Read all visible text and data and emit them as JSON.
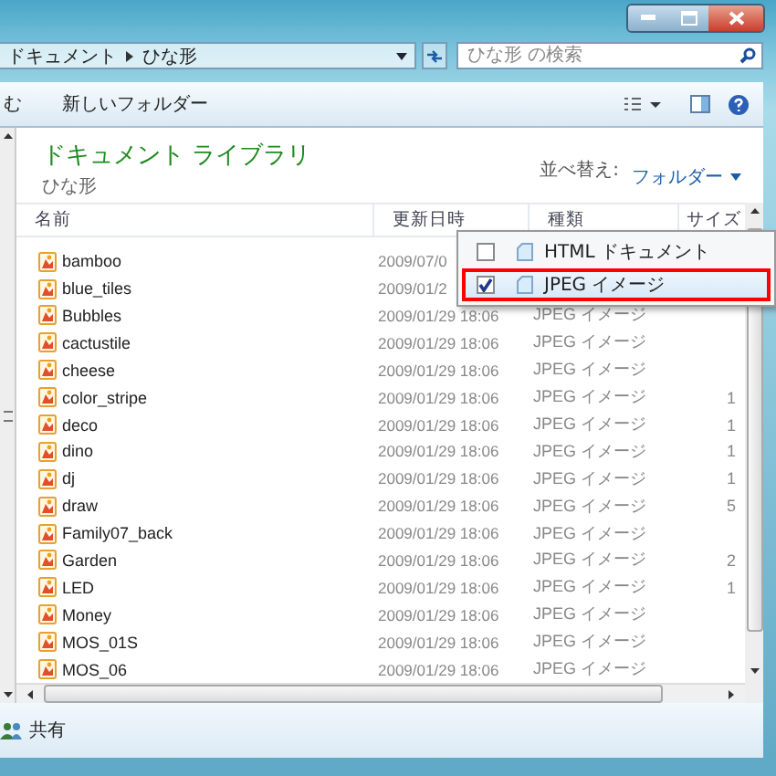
{
  "address": {
    "crumbs": [
      "ドキュメント",
      "ひな形"
    ]
  },
  "search": {
    "placeholder": "ひな形 の検索"
  },
  "toolbar": {
    "partial_label": "む",
    "new_folder": "新しいフォルダー"
  },
  "library": {
    "title": "ドキュメント ライブラリ",
    "subtitle": "ひな形",
    "sort_label": "並べ替え:",
    "sort_value": "フォルダー"
  },
  "columns": [
    "名前",
    "更新日時",
    "種類",
    "サイズ"
  ],
  "rows": [
    {
      "name": "bamboo",
      "date": "2009/07/0",
      "type": "",
      "size": ""
    },
    {
      "name": "blue_tiles",
      "date": "2009/01/2",
      "type": "",
      "size": ""
    },
    {
      "name": "Bubbles",
      "date": "2009/01/29 18:06",
      "type": "JPEG イメージ",
      "size": ""
    },
    {
      "name": "cactustile",
      "date": "2009/01/29 18:06",
      "type": "JPEG イメージ",
      "size": ""
    },
    {
      "name": "cheese",
      "date": "2009/01/29 18:06",
      "type": "JPEG イメージ",
      "size": ""
    },
    {
      "name": "color_stripe",
      "date": "2009/01/29 18:06",
      "type": "JPEG イメージ",
      "size": "1"
    },
    {
      "name": "deco",
      "date": "2009/01/29 18:06",
      "type": "JPEG イメージ",
      "size": "1"
    },
    {
      "name": "dino",
      "date": "2009/01/29 18:06",
      "type": "JPEG イメージ",
      "size": "1"
    },
    {
      "name": "dj",
      "date": "2009/01/29 18:06",
      "type": "JPEG イメージ",
      "size": "1"
    },
    {
      "name": "draw",
      "date": "2009/01/29 18:06",
      "type": "JPEG イメージ",
      "size": "5"
    },
    {
      "name": "Family07_back",
      "date": "2009/01/29 18:06",
      "type": "JPEG イメージ",
      "size": ""
    },
    {
      "name": "Garden",
      "date": "2009/01/29 18:06",
      "type": "JPEG イメージ",
      "size": "2"
    },
    {
      "name": "LED",
      "date": "2009/01/29 18:06",
      "type": "JPEG イメージ",
      "size": "1"
    },
    {
      "name": "Money",
      "date": "2009/01/29 18:06",
      "type": "JPEG イメージ",
      "size": ""
    },
    {
      "name": "MOS_01S",
      "date": "2009/01/29 18:06",
      "type": "JPEG イメージ",
      "size": ""
    },
    {
      "name": "MOS_06",
      "date": "2009/01/29 18:06",
      "type": "JPEG イメージ",
      "size": ""
    }
  ],
  "dropdown": {
    "items": [
      {
        "label": "HTML ドキュメント",
        "checked": false,
        "selected": false
      },
      {
        "label": "JPEG イメージ",
        "checked": true,
        "selected": true
      }
    ]
  },
  "details": {
    "label": "共有"
  }
}
